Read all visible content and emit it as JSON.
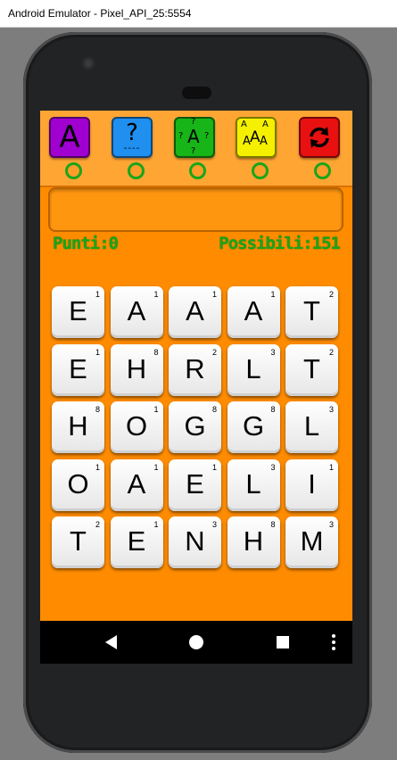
{
  "window": {
    "title": "Android Emulator - Pixel_API_25:5554"
  },
  "toolbar": {
    "buttons": [
      {
        "label": "A",
        "icon": "letter-a-icon",
        "color": "#a000d0"
      },
      {
        "label": "?",
        "icon": "question-icon",
        "color": "#1f8ff0"
      },
      {
        "label": "A",
        "icon": "letter-questions-icon",
        "color": "#17b517"
      },
      {
        "label": "A",
        "icon": "shuffle-letters-icon",
        "color": "#f4f000"
      },
      {
        "label": "",
        "icon": "refresh-icon",
        "color": "#e81010"
      }
    ]
  },
  "score": {
    "points_label": "Punti:0",
    "possible_label": "Possibili:151"
  },
  "grid": {
    "rows": [
      [
        {
          "l": "E",
          "p": "1"
        },
        {
          "l": "A",
          "p": "1"
        },
        {
          "l": "A",
          "p": "1"
        },
        {
          "l": "A",
          "p": "1"
        },
        {
          "l": "T",
          "p": "2"
        }
      ],
      [
        {
          "l": "E",
          "p": "1"
        },
        {
          "l": "H",
          "p": "8"
        },
        {
          "l": "R",
          "p": "2"
        },
        {
          "l": "L",
          "p": "3"
        },
        {
          "l": "T",
          "p": "2"
        }
      ],
      [
        {
          "l": "H",
          "p": "8"
        },
        {
          "l": "O",
          "p": "1"
        },
        {
          "l": "G",
          "p": "8"
        },
        {
          "l": "G",
          "p": "8"
        },
        {
          "l": "L",
          "p": "3"
        }
      ],
      [
        {
          "l": "O",
          "p": "1"
        },
        {
          "l": "A",
          "p": "1"
        },
        {
          "l": "E",
          "p": "1"
        },
        {
          "l": "L",
          "p": "3"
        },
        {
          "l": "I",
          "p": "1"
        }
      ],
      [
        {
          "l": "T",
          "p": "2"
        },
        {
          "l": "E",
          "p": "1"
        },
        {
          "l": "N",
          "p": "3"
        },
        {
          "l": "H",
          "p": "8"
        },
        {
          "l": "M",
          "p": "3"
        }
      ]
    ]
  },
  "nav": [
    "back-icon",
    "home-icon",
    "recents-icon",
    "more-icon"
  ]
}
